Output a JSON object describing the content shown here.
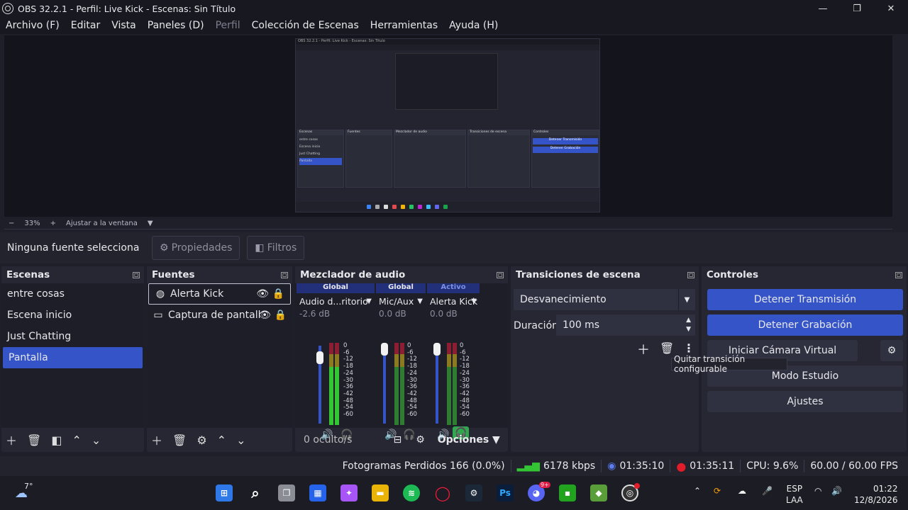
{
  "window": {
    "title": "OBS 32.2.1 - Perfil: Live Kick - Escenas: Sin Título",
    "minimize": "—",
    "maximize": "❐",
    "close": "✕"
  },
  "menu": [
    "Archivo (F)",
    "Editar",
    "Vista",
    "Paneles (D)",
    "Perfil",
    "Colección de Escenas",
    "Herramientas",
    "Ayuda (H)"
  ],
  "preview": {
    "zoom_minus": "−",
    "zoom_level": "33%",
    "zoom_plus": "+",
    "fit_label": "Ajustar a la ventana",
    "fit_dropdown": "▼"
  },
  "source_bar": {
    "no_selection": "Ninguna fuente selecciona",
    "properties": "Propiedades",
    "filters": "Filtros"
  },
  "scenes": {
    "title": "Escenas",
    "items": [
      "entre cosas",
      "Escena inicio",
      "Just Chatting",
      "Pantalla"
    ],
    "selected_index": 3
  },
  "sources": {
    "title": "Fuentes",
    "items": [
      "Alerta Kick",
      "Captura de pantall"
    ]
  },
  "mixer": {
    "title": "Mezclador de audio",
    "channels": [
      {
        "badge": "Global",
        "name": "Audio d...ritorio",
        "db": "-2.6 dB",
        "badge_color": "#22307a"
      },
      {
        "badge": "Global",
        "name": "Mic/Aux",
        "db": "0.0 dB",
        "badge_color": "#22307a"
      },
      {
        "badge": "Activo",
        "name": "Alerta Kick",
        "db": "0.0 dB",
        "badge_color": "#22307a"
      }
    ],
    "ticks": [
      "0",
      "-6",
      "-12",
      "-18",
      "-24",
      "-30",
      "-36",
      "-42",
      "-48",
      "-54",
      "-60"
    ],
    "hidden": "0 oculto/s",
    "options": "Opciones"
  },
  "transitions": {
    "title": "Transiciones de escena",
    "selected": "Desvanecimiento",
    "duration_label": "Duración",
    "duration_value": "100 ms",
    "tooltip": "Quitar transición configurable"
  },
  "controls": {
    "title": "Controles",
    "stop_stream": "Detener Transmisión",
    "stop_record": "Detener Grabación",
    "virtual_cam": "Iniciar Cámara Virtual",
    "studio_mode": "Modo Estudio",
    "settings": "Ajustes"
  },
  "status": {
    "dropped": "Fotogramas Perdidos 166 (0.0%)",
    "bitrate": "6178 kbps",
    "stream_time": "01:35:10",
    "rec_time": "01:35:11",
    "cpu": "CPU: 9.6%",
    "fps": "60.00 / 60.00 FPS"
  },
  "taskbar": {
    "weather": "7°",
    "lang_top": "ESP",
    "lang_bottom": "LAA",
    "time": "01:22",
    "date": "12/8/2026",
    "discord_badge": "9+",
    "ps_label": "Ps"
  },
  "preview_inner": {
    "title": "OBS 32.2.1 - Perfil: Live Kick - Escenas: Sin Título",
    "scenes": [
      "entre cosas",
      "Escena inicio",
      "Just Chatting",
      "Pantalla"
    ],
    "btn1": "Detener Transmisión",
    "btn2": "Detener Grabación"
  }
}
